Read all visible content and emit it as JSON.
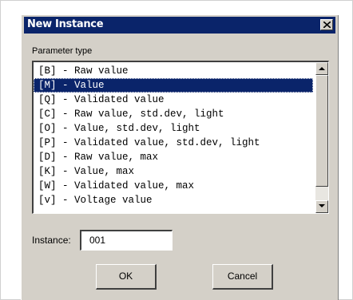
{
  "dialog": {
    "title": "New Instance",
    "close_icon": "close-x",
    "param_label": "Parameter type",
    "selected_index": 1,
    "items": [
      "[B] - Raw value",
      "[M] - Value",
      "[Q] - Validated value",
      "[C] - Raw value, std.dev, light",
      "[O] - Value, std.dev, light",
      "[P] - Validated value, std.dev, light",
      "[D] - Raw value, max",
      "[K] - Value, max",
      "[W] - Validated value, max",
      "[v] - Voltage value"
    ],
    "instance_label": "Instance:",
    "instance_value": "001",
    "ok_label": "OK",
    "cancel_label": "Cancel"
  },
  "colors": {
    "titlebar": "#0a246a",
    "face": "#d4d0c8",
    "selection": "#0a246a"
  }
}
